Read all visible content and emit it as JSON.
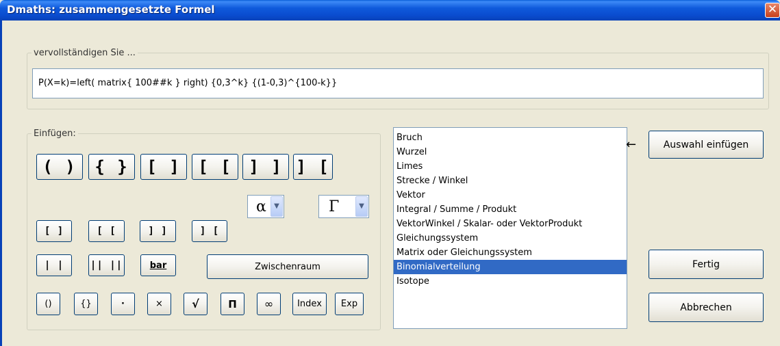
{
  "window": {
    "title": "Dmaths: zusammengesetzte Formel",
    "close": "✕"
  },
  "formula_group": {
    "legend": "vervollständigen Sie ...",
    "value": "P(X=k)=left( matrix{ 100##k } right) {0,3^k} {(1-0,3)^{100-k}}"
  },
  "insert_group": {
    "legend": "Einfügen:",
    "big_brackets": [
      "( )",
      "{ }",
      "[ ]",
      "[ [",
      "] ]",
      "] ["
    ],
    "small_brackets": [
      "[ ]",
      "[ [",
      "] ]",
      "] ["
    ],
    "row3": {
      "abs": "| |",
      "norm": "|| ||",
      "bar": "bar",
      "space": "Zwischenraum"
    },
    "row4": [
      "()",
      "{}",
      "·",
      "×",
      "√",
      "Π",
      "∞",
      "Index",
      "Exp"
    ],
    "greek_lower": "α",
    "greek_upper": "Γ",
    "dropdown_arrow": "▼"
  },
  "templates": {
    "items": [
      "Bruch",
      "Wurzel",
      "Limes",
      "Strecke / Winkel",
      "Vektor",
      "Integral / Summe / Produkt",
      "VektorWinkel / Skalar- oder VektorProdukt",
      "Gleichungssystem",
      "Matrix oder Gleichungssystem",
      "Binomialverteilung",
      "Isotope"
    ],
    "selected_index": 9,
    "arrow": "←"
  },
  "actions": {
    "insert": "Auswahl einfügen",
    "done": "Fertig",
    "cancel": "Abbrechen"
  }
}
